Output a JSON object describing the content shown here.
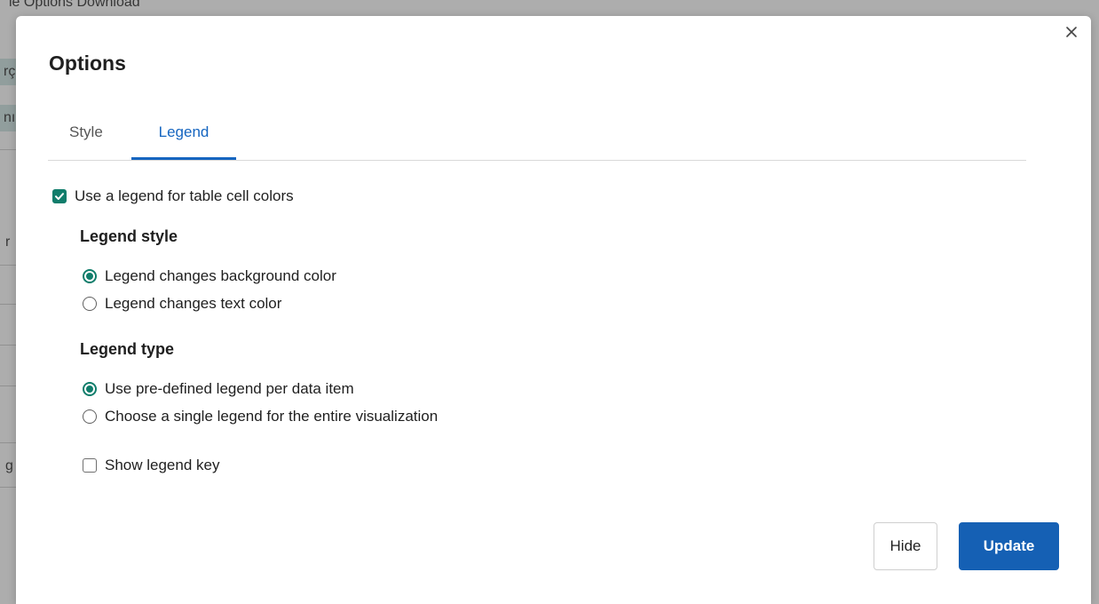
{
  "background": {
    "header_text": "le   Options   Download",
    "cells": [
      "rç",
      "nı"
    ],
    "texts": [
      "r",
      "g"
    ]
  },
  "dialog": {
    "title": "Options",
    "close_icon": "close-icon",
    "tabs": [
      {
        "label": "Style",
        "active": false
      },
      {
        "label": "Legend",
        "active": true
      }
    ],
    "use_legend": {
      "label": "Use a legend for table cell colors",
      "checked": true
    },
    "legend_style": {
      "heading": "Legend style",
      "options": [
        {
          "label": "Legend changes background color",
          "selected": true
        },
        {
          "label": "Legend changes text color",
          "selected": false
        }
      ]
    },
    "legend_type": {
      "heading": "Legend type",
      "options": [
        {
          "label": "Use pre-defined legend per data item",
          "selected": true
        },
        {
          "label": "Choose a single legend for the entire visualization",
          "selected": false
        }
      ]
    },
    "show_legend_key": {
      "label": "Show legend key",
      "checked": false
    },
    "buttons": {
      "hide": "Hide",
      "update": "Update"
    }
  },
  "colors": {
    "accent_teal": "#107d6b",
    "tab_active_blue": "#1565c0",
    "primary_button": "#1560b4"
  }
}
